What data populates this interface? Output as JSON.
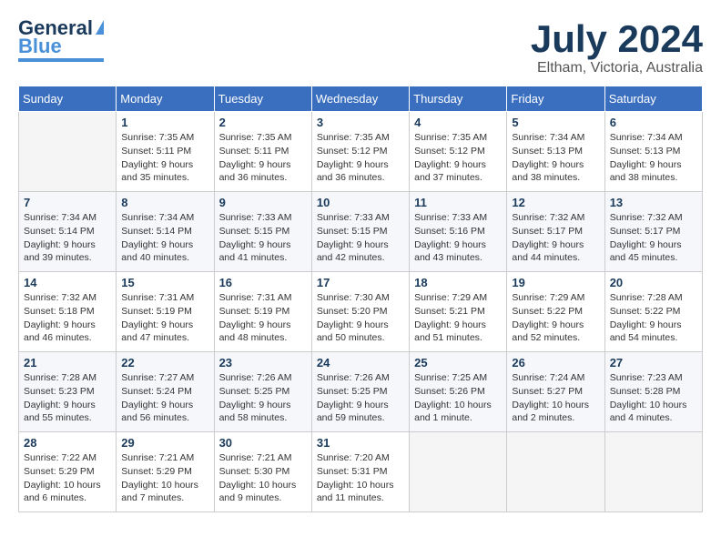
{
  "logo": {
    "line1": "General",
    "line2": "Blue"
  },
  "title": {
    "month_year": "July 2024",
    "location": "Eltham, Victoria, Australia"
  },
  "calendar": {
    "days_of_week": [
      "Sunday",
      "Monday",
      "Tuesday",
      "Wednesday",
      "Thursday",
      "Friday",
      "Saturday"
    ],
    "weeks": [
      [
        {
          "day": "",
          "info": ""
        },
        {
          "day": "1",
          "info": "Sunrise: 7:35 AM\nSunset: 5:11 PM\nDaylight: 9 hours\nand 35 minutes."
        },
        {
          "day": "2",
          "info": "Sunrise: 7:35 AM\nSunset: 5:11 PM\nDaylight: 9 hours\nand 36 minutes."
        },
        {
          "day": "3",
          "info": "Sunrise: 7:35 AM\nSunset: 5:12 PM\nDaylight: 9 hours\nand 36 minutes."
        },
        {
          "day": "4",
          "info": "Sunrise: 7:35 AM\nSunset: 5:12 PM\nDaylight: 9 hours\nand 37 minutes."
        },
        {
          "day": "5",
          "info": "Sunrise: 7:34 AM\nSunset: 5:13 PM\nDaylight: 9 hours\nand 38 minutes."
        },
        {
          "day": "6",
          "info": "Sunrise: 7:34 AM\nSunset: 5:13 PM\nDaylight: 9 hours\nand 38 minutes."
        }
      ],
      [
        {
          "day": "7",
          "info": "Sunrise: 7:34 AM\nSunset: 5:14 PM\nDaylight: 9 hours\nand 39 minutes."
        },
        {
          "day": "8",
          "info": "Sunrise: 7:34 AM\nSunset: 5:14 PM\nDaylight: 9 hours\nand 40 minutes."
        },
        {
          "day": "9",
          "info": "Sunrise: 7:33 AM\nSunset: 5:15 PM\nDaylight: 9 hours\nand 41 minutes."
        },
        {
          "day": "10",
          "info": "Sunrise: 7:33 AM\nSunset: 5:15 PM\nDaylight: 9 hours\nand 42 minutes."
        },
        {
          "day": "11",
          "info": "Sunrise: 7:33 AM\nSunset: 5:16 PM\nDaylight: 9 hours\nand 43 minutes."
        },
        {
          "day": "12",
          "info": "Sunrise: 7:32 AM\nSunset: 5:17 PM\nDaylight: 9 hours\nand 44 minutes."
        },
        {
          "day": "13",
          "info": "Sunrise: 7:32 AM\nSunset: 5:17 PM\nDaylight: 9 hours\nand 45 minutes."
        }
      ],
      [
        {
          "day": "14",
          "info": "Sunrise: 7:32 AM\nSunset: 5:18 PM\nDaylight: 9 hours\nand 46 minutes."
        },
        {
          "day": "15",
          "info": "Sunrise: 7:31 AM\nSunset: 5:19 PM\nDaylight: 9 hours\nand 47 minutes."
        },
        {
          "day": "16",
          "info": "Sunrise: 7:31 AM\nSunset: 5:19 PM\nDaylight: 9 hours\nand 48 minutes."
        },
        {
          "day": "17",
          "info": "Sunrise: 7:30 AM\nSunset: 5:20 PM\nDaylight: 9 hours\nand 50 minutes."
        },
        {
          "day": "18",
          "info": "Sunrise: 7:29 AM\nSunset: 5:21 PM\nDaylight: 9 hours\nand 51 minutes."
        },
        {
          "day": "19",
          "info": "Sunrise: 7:29 AM\nSunset: 5:22 PM\nDaylight: 9 hours\nand 52 minutes."
        },
        {
          "day": "20",
          "info": "Sunrise: 7:28 AM\nSunset: 5:22 PM\nDaylight: 9 hours\nand 54 minutes."
        }
      ],
      [
        {
          "day": "21",
          "info": "Sunrise: 7:28 AM\nSunset: 5:23 PM\nDaylight: 9 hours\nand 55 minutes."
        },
        {
          "day": "22",
          "info": "Sunrise: 7:27 AM\nSunset: 5:24 PM\nDaylight: 9 hours\nand 56 minutes."
        },
        {
          "day": "23",
          "info": "Sunrise: 7:26 AM\nSunset: 5:25 PM\nDaylight: 9 hours\nand 58 minutes."
        },
        {
          "day": "24",
          "info": "Sunrise: 7:26 AM\nSunset: 5:25 PM\nDaylight: 9 hours\nand 59 minutes."
        },
        {
          "day": "25",
          "info": "Sunrise: 7:25 AM\nSunset: 5:26 PM\nDaylight: 10 hours\nand 1 minute."
        },
        {
          "day": "26",
          "info": "Sunrise: 7:24 AM\nSunset: 5:27 PM\nDaylight: 10 hours\nand 2 minutes."
        },
        {
          "day": "27",
          "info": "Sunrise: 7:23 AM\nSunset: 5:28 PM\nDaylight: 10 hours\nand 4 minutes."
        }
      ],
      [
        {
          "day": "28",
          "info": "Sunrise: 7:22 AM\nSunset: 5:29 PM\nDaylight: 10 hours\nand 6 minutes."
        },
        {
          "day": "29",
          "info": "Sunrise: 7:21 AM\nSunset: 5:29 PM\nDaylight: 10 hours\nand 7 minutes."
        },
        {
          "day": "30",
          "info": "Sunrise: 7:21 AM\nSunset: 5:30 PM\nDaylight: 10 hours\nand 9 minutes."
        },
        {
          "day": "31",
          "info": "Sunrise: 7:20 AM\nSunset: 5:31 PM\nDaylight: 10 hours\nand 11 minutes."
        },
        {
          "day": "",
          "info": ""
        },
        {
          "day": "",
          "info": ""
        },
        {
          "day": "",
          "info": ""
        }
      ]
    ]
  }
}
